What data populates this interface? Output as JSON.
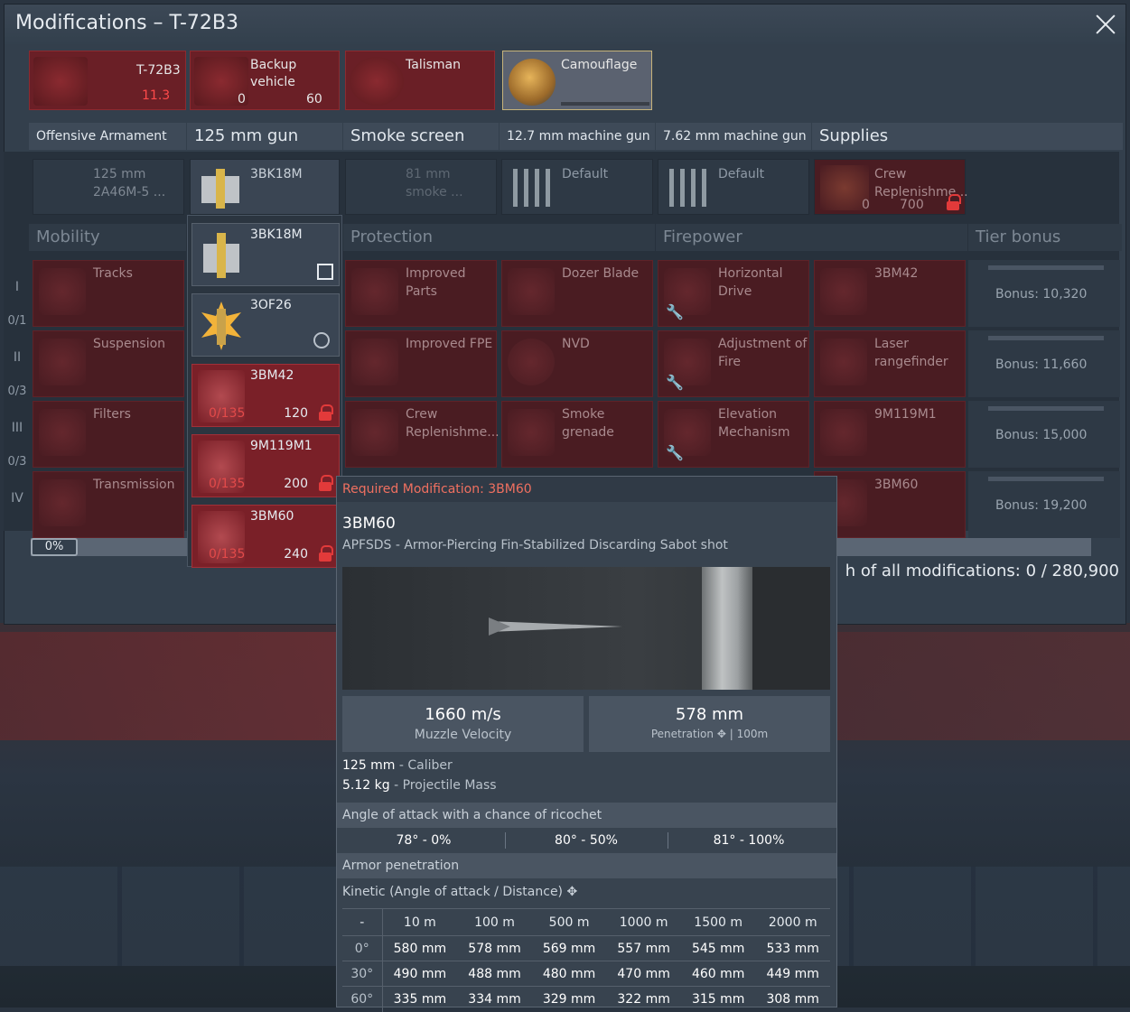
{
  "window": {
    "title": "Modifications – T-72B3"
  },
  "top_cards": {
    "vehicle": {
      "name": "T-72B3",
      "rank": "11.3"
    },
    "backup": {
      "label": "Backup vehicle",
      "count": "0",
      "price": "60"
    },
    "talisman": {
      "label": "Talisman"
    },
    "camouflage": {
      "label": "Camouflage"
    }
  },
  "categories": {
    "offensive": "Offensive Armament",
    "gun": "125 mm gun",
    "smoke": "Smoke screen",
    "mg127": "12.7 mm machine gun",
    "mg762": "7.62 mm machine gun",
    "supplies": "Supplies"
  },
  "slots": {
    "gun": "125 mm 2A46M-5 ...",
    "shell": "3BK18M",
    "smoke": "81 mm smoke ...",
    "mg127": "Default",
    "mg762": "Default",
    "crew": "Crew Replenishme...",
    "crew_count": "0",
    "crew_price": "700"
  },
  "sections": {
    "mobility": "Mobility",
    "protection": "Protection",
    "firepower": "Firepower",
    "tier_bonus": "Tier bonus"
  },
  "tiers": [
    {
      "roman": "I",
      "count": "0/1"
    },
    {
      "roman": "II",
      "count": "0/3"
    },
    {
      "roman": "III",
      "count": "0/3"
    },
    {
      "roman": "IV",
      "count": ""
    }
  ],
  "mods": {
    "tracks": "Tracks",
    "suspension": "Suspension",
    "filters": "Filters",
    "transmission": "Transmission",
    "improved_parts": "Improved Parts",
    "improved_fpe": "Improved FPE",
    "crew_repl": "Crew Replenishme...",
    "dozer": "Dozer Blade",
    "nvd": "NVD",
    "smoke_grenade": "Smoke grenade",
    "horizontal_drive": "Horizontal Drive",
    "adjustment_fire": "Adjustment of Fire",
    "elevation": "Elevation Mechanism",
    "bm42": "3BM42",
    "laser": "Laser rangefinder",
    "m119": "9M119M1",
    "bm60": "3BM60"
  },
  "bonuses": [
    "Bonus: 10,320",
    "Bonus: 11,660",
    "Bonus: 15,000",
    "Bonus: 19,200"
  ],
  "progress": {
    "percent_label": "0%",
    "value": 0
  },
  "worth": {
    "text": "h of all modifications: 0",
    "total": "/ 280,900"
  },
  "dropdown": [
    {
      "name": "3BK18M",
      "state": "selected"
    },
    {
      "name": "3OF26",
      "state": "available"
    },
    {
      "name": "3BM42",
      "count": "0/135",
      "price": "120",
      "state": "locked"
    },
    {
      "name": "9M119M1",
      "count": "0/135",
      "price": "200",
      "state": "locked"
    },
    {
      "name": "3BM60",
      "count": "0/135",
      "price": "240",
      "state": "locked"
    }
  ],
  "tooltip": {
    "required": "Required Modification: 3BM60",
    "name": "3BM60",
    "desc": "APFSDS - Armor-Piercing Fin-Stabilized Discarding Sabot shot",
    "velocity_value": "1660 m/s",
    "velocity_label": "Muzzle Velocity",
    "pen_value": "578 mm",
    "pen_label": "Penetration",
    "pen_dist": "| 100m",
    "caliber_value": "125 mm",
    "caliber_label": " - Caliber",
    "mass_value": "5.12 kg",
    "mass_label": " - Projectile Mass",
    "ricochet_title": "Angle of attack with a chance of ricochet",
    "ricochet": [
      "78° - 0%",
      "80° - 50%",
      "81° - 100%"
    ],
    "armor_title": "Armor penetration",
    "kinetic_label": "Kinetic (Angle of attack / Distance)",
    "table": {
      "header": [
        "-",
        "10 m",
        "100 m",
        "500 m",
        "1000 m",
        "1500 m",
        "2000 m"
      ],
      "rows": [
        [
          "0°",
          "580 mm",
          "578 mm",
          "569 mm",
          "557 mm",
          "545 mm",
          "533 mm"
        ],
        [
          "30°",
          "490 mm",
          "488 mm",
          "480 mm",
          "470 mm",
          "460 mm",
          "449 mm"
        ],
        [
          "60°",
          "335 mm",
          "334 mm",
          "329 mm",
          "322 mm",
          "315 mm",
          "308 mm"
        ]
      ]
    }
  },
  "colors": {
    "locked_red": "#7a2028",
    "accent_red": "#e23a3a",
    "header": "#3e4a58"
  }
}
